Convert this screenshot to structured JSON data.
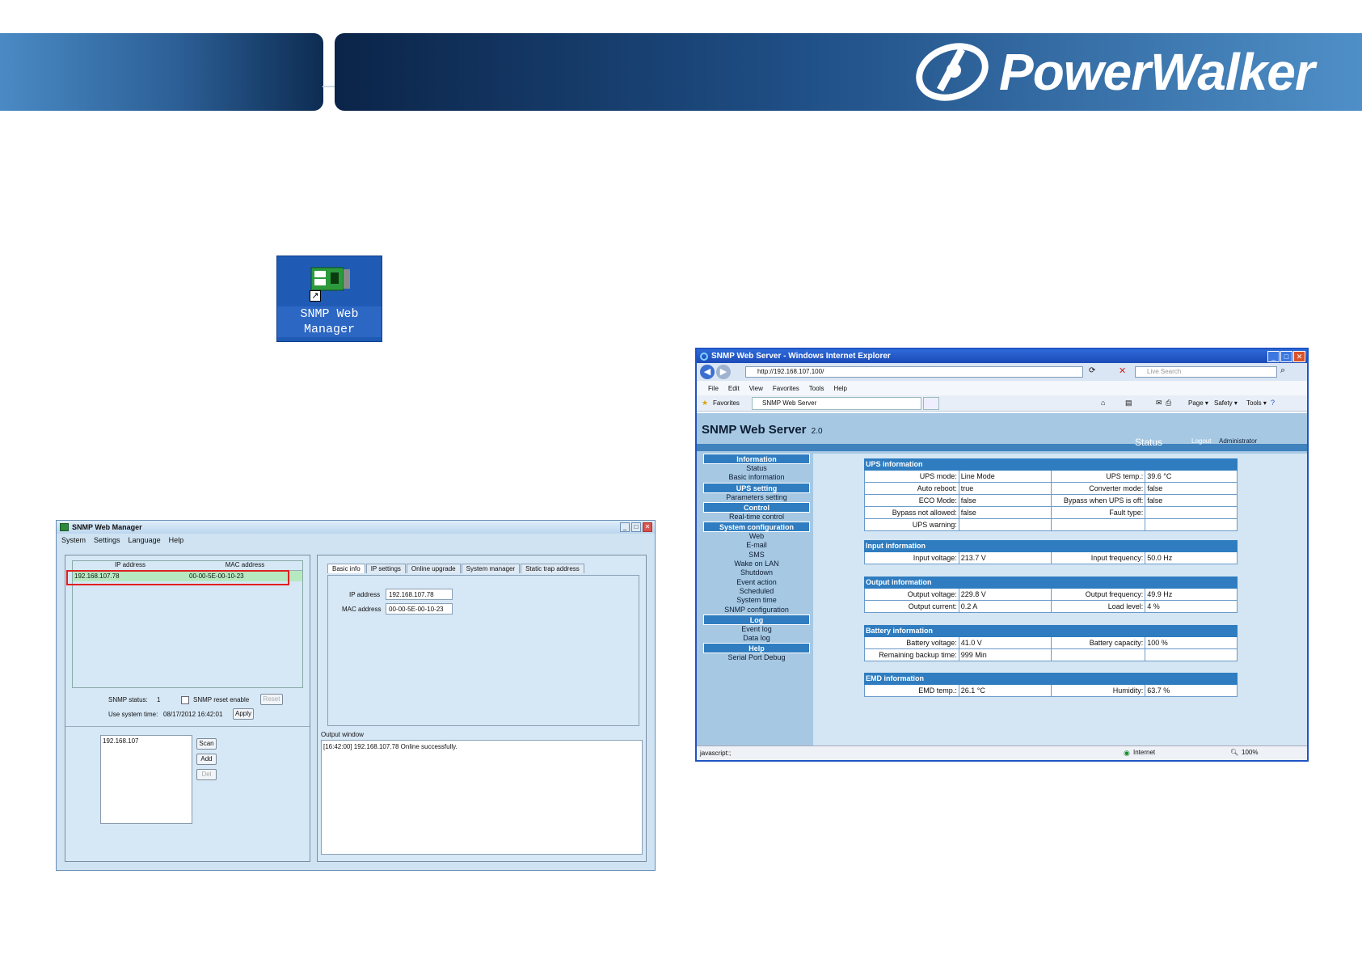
{
  "brand": {
    "name": "PowerWalker"
  },
  "desktop_icon": {
    "label_line1": "SNMP Web",
    "label_line2": "Manager"
  },
  "manager": {
    "title": "SNMP Web Manager",
    "menu": [
      "System",
      "Settings",
      "Language",
      "Help"
    ],
    "list_headers": [
      "IP address",
      "MAC address"
    ],
    "device": {
      "ip": "192.168.107.78",
      "mac": "00-00-5E-00-10-23"
    },
    "snmp_status_label": "SNMP status:",
    "snmp_status_value": "1",
    "snmp_reset_label": "SNMP reset enable",
    "reset_button": "Reset",
    "system_time_label": "Use system time:",
    "system_time_value": "08/17/2012 16:42:01",
    "apply_button": "Apply",
    "scan_ip": "192.168.107",
    "scan_button": "Scan",
    "add_button": "Add",
    "del_button": "Del",
    "tabs": [
      "Basic info",
      "IP settings",
      "Online upgrade",
      "System manager",
      "Static trap address"
    ],
    "ip_label": "IP address",
    "ip_value": "192.168.107.78",
    "mac_label": "MAC address",
    "mac_value": "00-00-5E-00-10-23",
    "output_label": "Output window",
    "output_line": "[16:42:00]   192.168.107.78 Online successfully."
  },
  "ie": {
    "title": "SNMP Web Server - Windows Internet Explorer",
    "url": "http://192.168.107.100/",
    "search_placeholder": "Live Search",
    "menu": [
      "File",
      "Edit",
      "View",
      "Favorites",
      "Tools",
      "Help"
    ],
    "favorites": "Favorites",
    "tab": "SNMP Web Server",
    "tool_page": "Page ▾",
    "tool_safety": "Safety ▾",
    "tool_tools": "Tools ▾",
    "status_text": "javascript:;",
    "zone": "Internet",
    "zoom": "100%"
  },
  "snmp": {
    "title": "SNMP Web Server",
    "version": "2.0",
    "status_link": "Status",
    "logout": "Logout",
    "user": "Administrator",
    "nav": [
      {
        "section": "Information",
        "items": [
          "Status",
          "Basic information"
        ]
      },
      {
        "section": "UPS setting",
        "items": [
          "Parameters setting"
        ]
      },
      {
        "section": "Control",
        "items": [
          "Real-time control"
        ]
      },
      {
        "section": "System configuration",
        "items": [
          "Web",
          "E-mail",
          "SMS",
          "Wake on LAN",
          "Shutdown",
          "Event action",
          "Scheduled",
          "System time",
          "SNMP configuration"
        ]
      },
      {
        "section": "Log",
        "items": [
          "Event log",
          "Data log"
        ]
      },
      {
        "section": "Help",
        "items": [
          "Serial Port Debug"
        ]
      }
    ],
    "groups": [
      {
        "title": "UPS information",
        "rows": [
          [
            "UPS mode:",
            "Line Mode",
            "UPS temp.:",
            "39.6 °C"
          ],
          [
            "Auto reboot:",
            "true",
            "Converter mode:",
            "false"
          ],
          [
            "ECO Mode:",
            "false",
            "Bypass when UPS is off:",
            "false"
          ],
          [
            "Bypass not allowed:",
            "false",
            "Fault type:",
            ""
          ],
          [
            "UPS warning:",
            "",
            "",
            ""
          ]
        ]
      },
      {
        "title": "Input information",
        "rows": [
          [
            "Input voltage:",
            "213.7 V",
            "Input frequency:",
            "50.0 Hz"
          ]
        ]
      },
      {
        "title": "Output information",
        "rows": [
          [
            "Output voltage:",
            "229.8 V",
            "Output frequency:",
            "49.9 Hz"
          ],
          [
            "Output current:",
            "0.2 A",
            "Load level:",
            "4 %"
          ]
        ]
      },
      {
        "title": "Battery information",
        "rows": [
          [
            "Battery voltage:",
            "41.0 V",
            "Battery capacity:",
            "100 %"
          ],
          [
            "Remaining backup time:",
            "999 Min",
            "",
            ""
          ]
        ]
      },
      {
        "title": "EMD information",
        "rows": [
          [
            "EMD temp.:",
            "26.1 °C",
            "Humidity:",
            "63.7 %"
          ]
        ]
      }
    ]
  }
}
